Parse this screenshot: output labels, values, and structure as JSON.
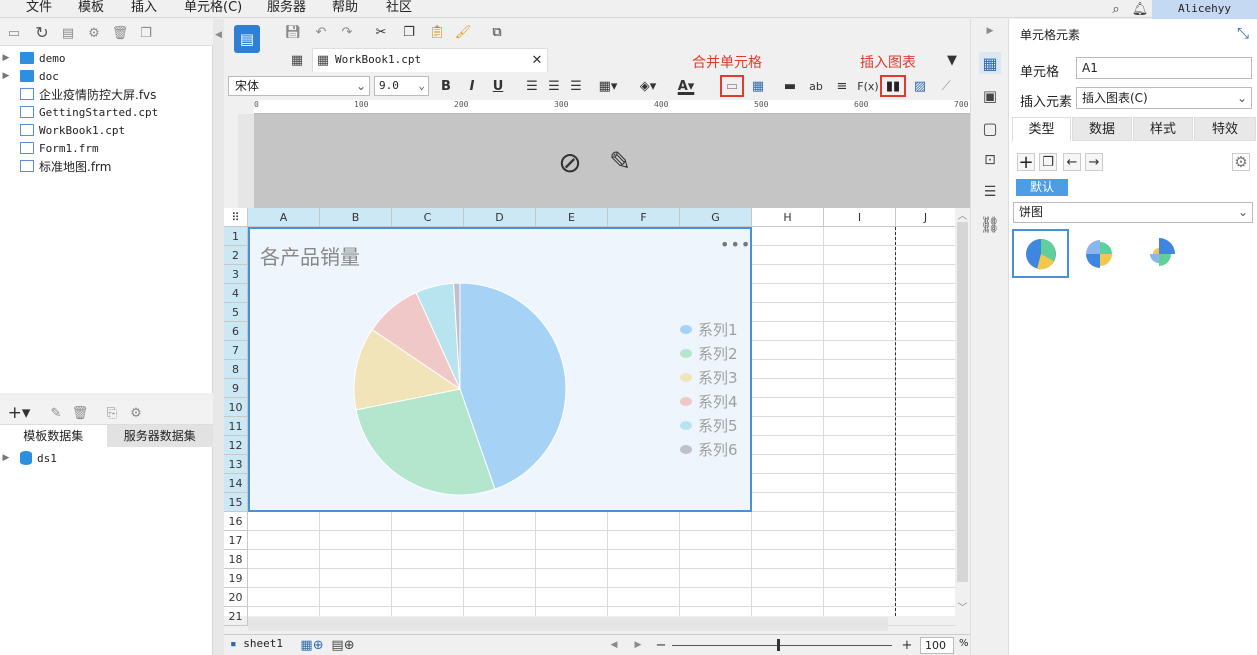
{
  "menu": {
    "items": [
      "文件",
      "模板",
      "插入",
      "单元格(C)",
      "服务器",
      "帮助",
      "社区"
    ],
    "user": "Alicehyy"
  },
  "left": {
    "files": [
      {
        "name": "demo",
        "type": "folder"
      },
      {
        "name": "doc",
        "type": "folder"
      },
      {
        "name": "企业疫情防控大屏.fvs",
        "type": "file"
      },
      {
        "name": "GettingStarted.cpt",
        "type": "file"
      },
      {
        "name": "WorkBook1.cpt",
        "type": "file"
      },
      {
        "name": "Form1.frm",
        "type": "file"
      },
      {
        "name": "标准地图.frm",
        "type": "file"
      }
    ],
    "dataset_tabs": [
      "模板数据集",
      "服务器数据集"
    ],
    "datasets": [
      "ds1"
    ]
  },
  "editor": {
    "tab_title": "WorkBook1.cpt",
    "font": "宋体",
    "font_size": "9.0",
    "annotations": {
      "merge": "合并单元格",
      "insert_chart": "插入图表"
    },
    "ruler_marks": [
      "0",
      "100",
      "200",
      "300",
      "400",
      "500",
      "600",
      "700"
    ],
    "columns": [
      "A",
      "B",
      "C",
      "D",
      "E",
      "F",
      "G",
      "H",
      "I",
      "J"
    ],
    "rows": [
      "1",
      "2",
      "3",
      "4",
      "5",
      "6",
      "7",
      "8",
      "9",
      "10",
      "11",
      "12",
      "13",
      "14",
      "15",
      "16",
      "17",
      "18",
      "19",
      "20",
      "21"
    ],
    "sheet": "sheet1",
    "zoom": "100",
    "zoom_unit": "%"
  },
  "chart_data": {
    "type": "pie",
    "title": "各产品销量",
    "categories": [
      "系列1",
      "系列2",
      "系列3",
      "系列4",
      "系列5",
      "系列6"
    ],
    "values": [
      46,
      28,
      13,
      9,
      6,
      1
    ],
    "colors": [
      "#a6d2f5",
      "#b3e6cc",
      "#f0e4b8",
      "#f0c8c8",
      "#b8e4ef",
      "#c0c0cc"
    ]
  },
  "right": {
    "title": "单元格元素",
    "cell_label": "单元格",
    "cell_value": "A1",
    "insert_label": "插入元素",
    "insert_value": "插入图表(C)",
    "tabs": [
      "类型",
      "数据",
      "样式",
      "特效"
    ],
    "default_tag": "默认",
    "chart_type": "饼图"
  }
}
